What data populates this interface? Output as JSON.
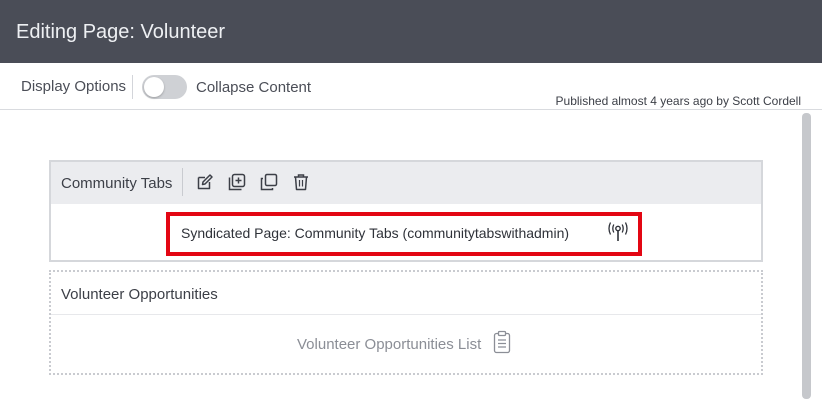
{
  "header": {
    "title": "Editing Page: Volunteer"
  },
  "toolbar": {
    "display_options_label": "Display Options",
    "collapse_content_label": "Collapse Content",
    "collapse_content_enabled": false,
    "published_text": "Published almost 4 years ago by Scott Cordell"
  },
  "widgets": [
    {
      "title": "Community Tabs",
      "tools": [
        "edit-icon",
        "add-content-icon",
        "copy-icon",
        "delete-icon"
      ],
      "syndicated_text": "Syndicated Page: Community Tabs (communitytabswithadmin)",
      "syndicated_icon": "broadcast-icon",
      "highlight_color": "#e30613"
    },
    {
      "title": "Volunteer Opportunities",
      "content_label": "Volunteer Opportunities List",
      "content_icon": "clipboard-icon"
    }
  ],
  "colors": {
    "header_bg": "#4a4d57",
    "widget_head_bg": "#ebecef",
    "accent_red": "#e30613"
  }
}
